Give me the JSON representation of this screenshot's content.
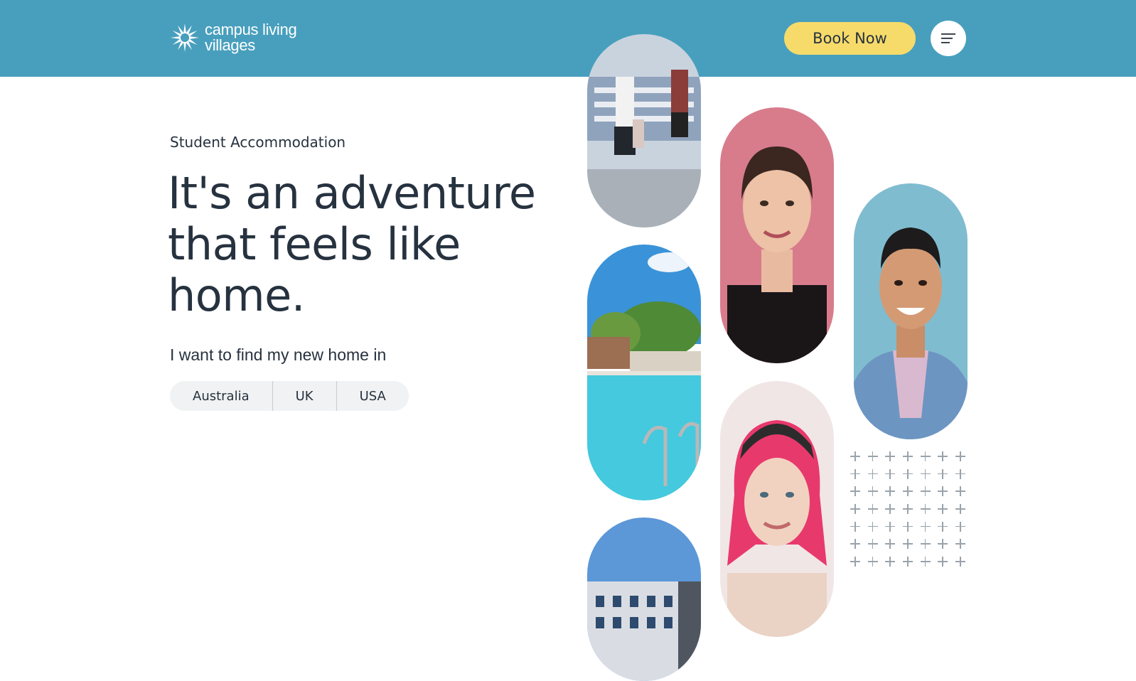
{
  "header": {
    "logo_line1": "campus living",
    "logo_line2": "villages",
    "book_label": "Book Now",
    "menu_icon": "hamburger-menu-icon",
    "background": "#489fbd",
    "button_color": "#f7db6a"
  },
  "hero": {
    "eyebrow": "Student Accommodation",
    "headline_line1": "It's an adventure",
    "headline_line2": "that feels like",
    "headline_line3": "home.",
    "find_label": "I want to find my new home in",
    "countries": [
      "Australia",
      "UK",
      "USA"
    ]
  },
  "gallery": {
    "images": [
      "basketball-players-photo",
      "swimming-pool-photo",
      "apartment-building-photo",
      "woman-braided-hair-photo",
      "man-denim-jacket-photo",
      "woman-pink-hair-photo"
    ]
  }
}
